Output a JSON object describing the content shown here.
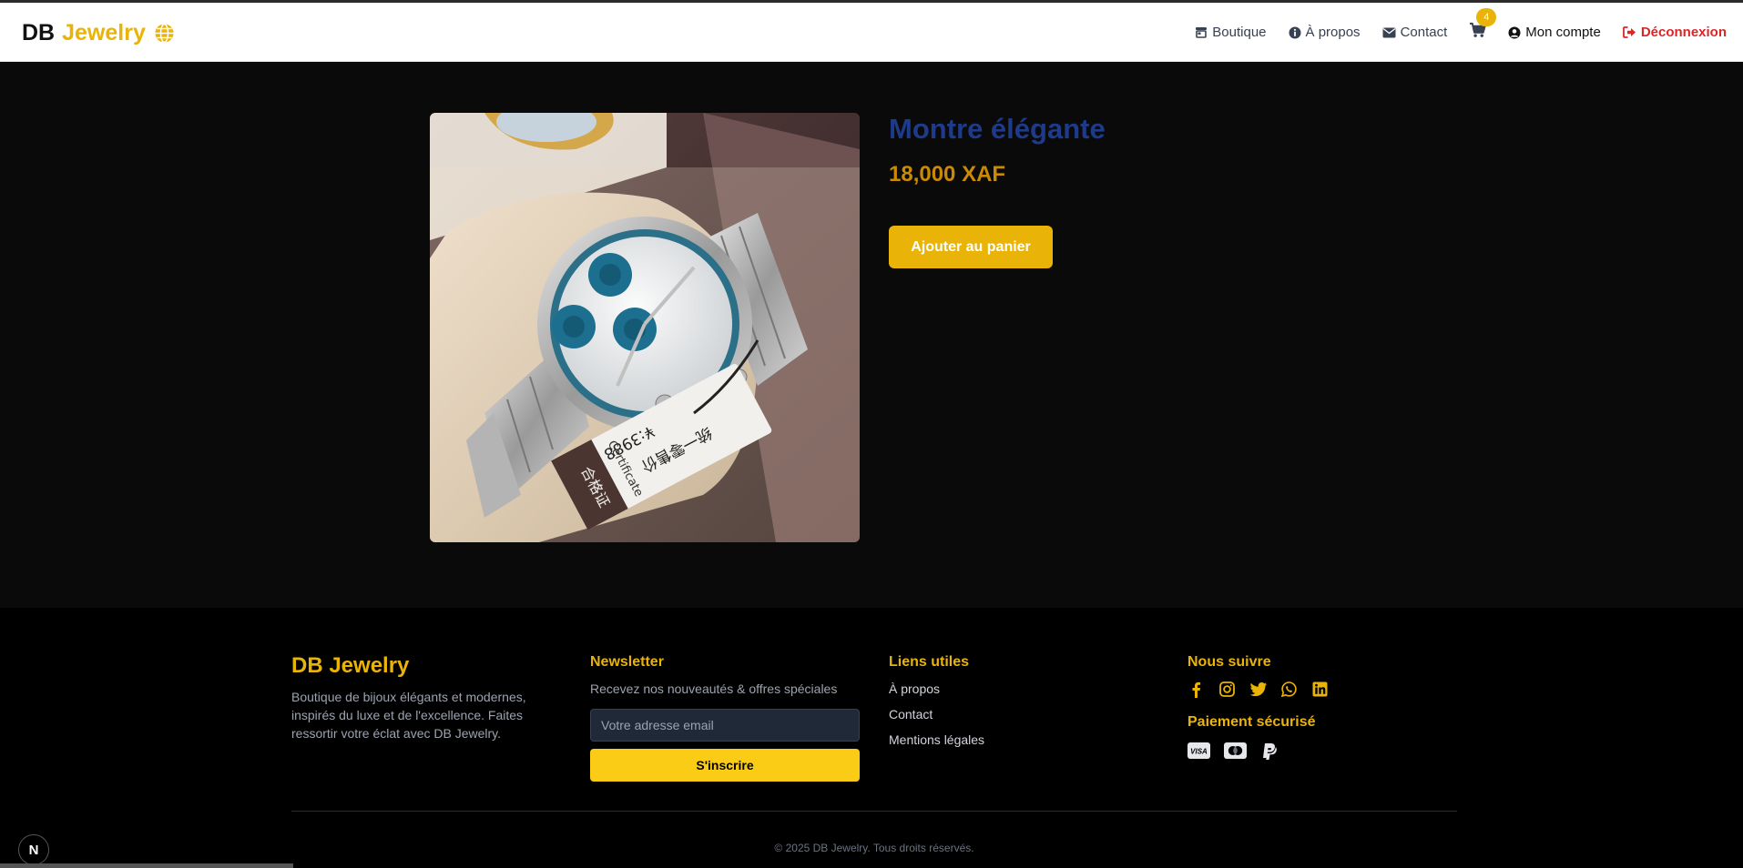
{
  "brand": {
    "part1": "DB",
    "part2": "Jewelry"
  },
  "nav": {
    "shop": "Boutique",
    "about": "À propos",
    "contact": "Contact",
    "cart_count": "4",
    "account": "Mon compte",
    "logout": "Déconnexion"
  },
  "product": {
    "title": "Montre élégante",
    "price": "18,000 XAF",
    "add_to_cart": "Ajouter au panier",
    "image_tag_price": "¥:3988",
    "image_tag_text": "统一零售价",
    "image_tag_cert": "Certificate",
    "image_tag_label": "合格证"
  },
  "footer": {
    "brand": "DB Jewelry",
    "description": "Boutique de bijoux élégants et modernes, inspirés du luxe et de l'excellence. Faites ressortir votre éclat avec DB Jewelry.",
    "newsletter_title": "Newsletter",
    "newsletter_text": "Recevez nos nouveautés & offres spéciales",
    "email_placeholder": "Votre adresse email",
    "subscribe": "S'inscrire",
    "links_title": "Liens utiles",
    "links": [
      "À propos",
      "Contact",
      "Mentions légales"
    ],
    "follow_title": "Nous suivre",
    "social_icons": [
      "facebook-icon",
      "instagram-icon",
      "twitter-icon",
      "whatsapp-icon",
      "linkedin-icon"
    ],
    "payment_title": "Paiement sécurisé",
    "payment_icons": [
      "visa-icon",
      "mastercard-icon",
      "paypal-icon"
    ],
    "copyright": "© 2025 DB Jewelry. Tous droits réservés."
  },
  "colors": {
    "accent": "#eab308",
    "title": "#1e3a8a",
    "price": "#ca8a04",
    "logout": "#dc2626",
    "page_bg": "#0a0a0a",
    "footer_bg": "#000000"
  },
  "dev_badge": "N"
}
